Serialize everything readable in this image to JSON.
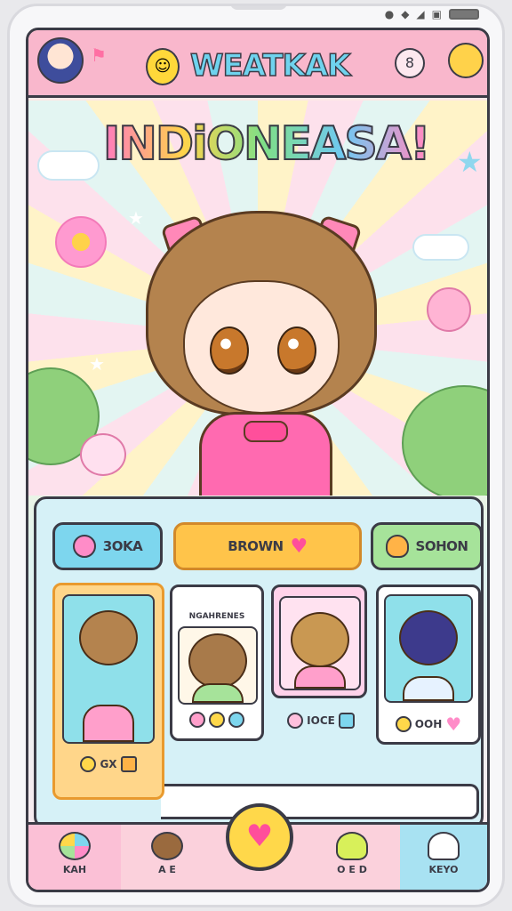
{
  "header": {
    "title": "WEATKAK",
    "settings_glyph": "8"
  },
  "hero": {
    "game_title": "INDiONEASA!"
  },
  "filters": [
    {
      "label": "3OKA",
      "color": "#7dd6ee"
    },
    {
      "label": "BROWN",
      "color": "#ffc44a",
      "selected": true
    },
    {
      "label": "SOHON",
      "color": "#a6e39a"
    }
  ],
  "cards": [
    {
      "caption": "",
      "stat_value": "GX",
      "hair_color": "#b4834e",
      "outfit_color": "#ff9fcb",
      "selected": true
    },
    {
      "caption": "NGAHRENES",
      "stat_value": "",
      "hair_color": "#a87a4a",
      "outfit_color": "#a6e39a"
    },
    {
      "caption": "",
      "stat_value": "IOCE",
      "hair_color": "#c99852",
      "outfit_color": "#ff9fcb"
    },
    {
      "caption": "",
      "stat_value": "OOH",
      "hair_color": "#3d3a8c",
      "outfit_color": "#e6f2ff"
    }
  ],
  "nav": {
    "items": [
      {
        "label": "KAH",
        "icon": "candy-icon"
      },
      {
        "label": "A E",
        "icon": "bear-icon"
      },
      {
        "label": "",
        "icon": "heart-icon"
      },
      {
        "label": "O E D",
        "icon": "slime-icon"
      },
      {
        "label": "KEYO",
        "icon": "ghost-icon"
      }
    ],
    "heart_glyph": "♥"
  },
  "colors": {
    "header": "#f9b7cc",
    "panel": "#d6f1f7",
    "outline": "#3b3b46",
    "accent": "#ff4f9b"
  }
}
